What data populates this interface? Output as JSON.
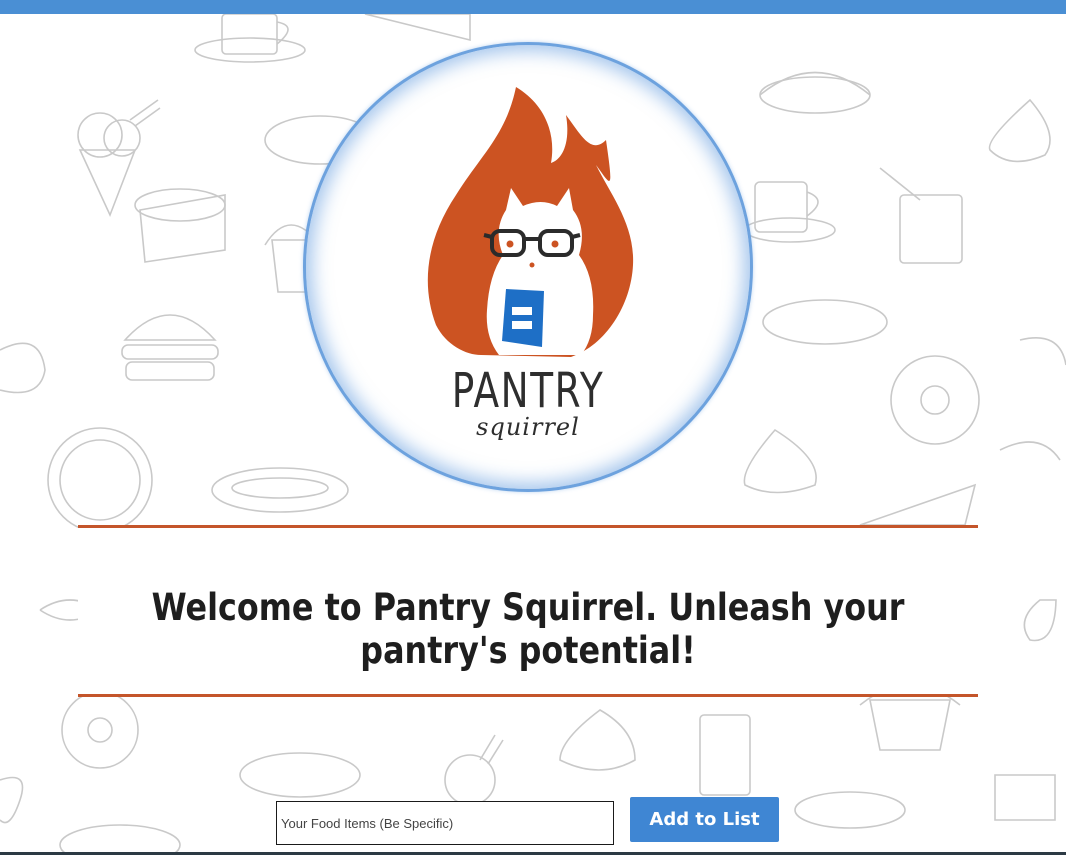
{
  "brand": {
    "logo_name": "PANTRY",
    "logo_sub": "squirrel",
    "colors": {
      "accent_blue": "#4a8fd4",
      "flame_orange": "#cc5322",
      "rule_orange": "#c4552a",
      "book_blue": "#1e6fc6"
    }
  },
  "welcome": {
    "text": "Welcome to Pantry Squirrel. Unleash your pantry's potential!"
  },
  "form": {
    "input_placeholder": "Your Food Items (Be Specific)",
    "input_value": "",
    "add_button_label": "Add to List"
  },
  "icons": {
    "logo": "squirrel-with-glasses-icon",
    "background": "food-doodle-pattern"
  }
}
